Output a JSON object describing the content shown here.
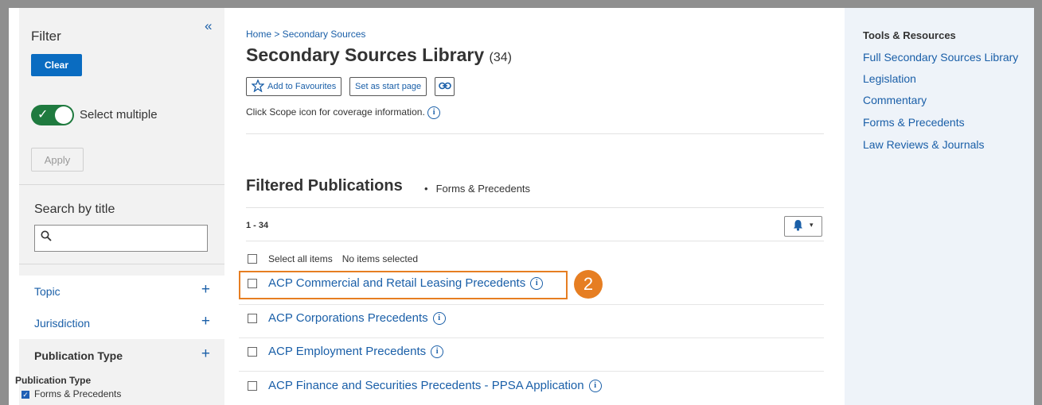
{
  "sidebar": {
    "title": "Filter",
    "collapse_icon": "«",
    "clear_label": "Clear",
    "toggle_label": "Select multiple",
    "apply_label": "Apply",
    "search_label": "Search by title",
    "search_value": "",
    "facets": [
      {
        "label": "Topic"
      },
      {
        "label": "Jurisdiction"
      },
      {
        "label": "Publication Type"
      }
    ],
    "pubtype_heading": "Publication Type",
    "pubtype_item": "Forms & Precedents"
  },
  "main": {
    "breadcrumb": "Home > Secondary Sources",
    "title": "Secondary Sources Library",
    "count": "(34)",
    "favourites_label": "Add to Favourites",
    "start_page_label": "Set as start page",
    "scope_text": "Click Scope icon for coverage information.",
    "filtered_title": "Filtered Publications",
    "filtered_sep": "•",
    "filtered_sub": "Forms & Precedents",
    "range": "1 - 34",
    "select_all": "Select all items",
    "no_selected": "No items selected",
    "publications": [
      "ACP Commercial and Retail Leasing Precedents",
      "ACP Corporations Precedents",
      "ACP Employment Precedents",
      "ACP Finance and Securities Precedents - PPSA Application"
    ],
    "step_badge": "2"
  },
  "right_panel": {
    "title": "Tools & Resources",
    "links": [
      "Full Secondary Sources Library",
      "Legislation",
      "Commentary",
      "Forms & Precedents",
      "Law Reviews & Journals"
    ]
  },
  "colors": {
    "link_blue": "#1a5fa8",
    "button_blue": "#0a6cc1",
    "toggle_green": "#1f7a3f",
    "highlight_orange": "#e67e22"
  }
}
